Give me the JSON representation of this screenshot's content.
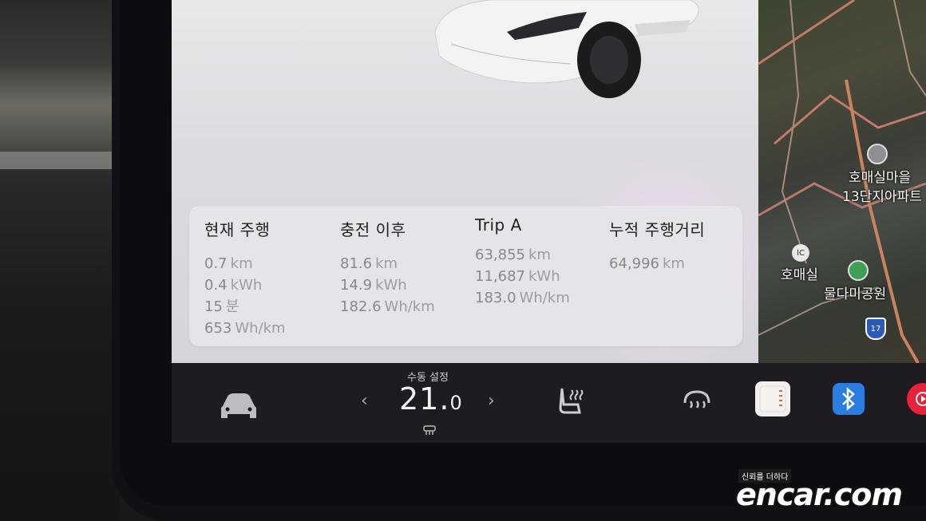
{
  "stats": {
    "current_trip": {
      "title": "현재 주행",
      "rows": [
        {
          "value": "0.7",
          "unit": "km"
        },
        {
          "value": "0.4",
          "unit": "kWh"
        },
        {
          "value": "15",
          "unit": "분"
        },
        {
          "value": "653",
          "unit": "Wh/km"
        }
      ]
    },
    "since_charge": {
      "title": "충전 이후",
      "rows": [
        {
          "value": "81.6",
          "unit": "km"
        },
        {
          "value": "14.9",
          "unit": "kWh"
        },
        {
          "value": "182.6",
          "unit": "Wh/km"
        }
      ]
    },
    "trip_a": {
      "title": "Trip A",
      "rows": [
        {
          "value": "63,855",
          "unit": "km"
        },
        {
          "value": "11,687",
          "unit": "kWh"
        },
        {
          "value": "183.0",
          "unit": "Wh/km"
        }
      ]
    },
    "odometer": {
      "title": "누적 주행거리",
      "rows": [
        {
          "value": "64,996",
          "unit": "km"
        }
      ]
    }
  },
  "map": {
    "labels": [
      "호매실마을",
      "13단지아파트",
      "IC",
      "호매실",
      "물다미공원",
      "17"
    ]
  },
  "climate": {
    "mode_label": "수동 설정",
    "temp_int": "21.",
    "temp_dec": "0",
    "left_chevron": "‹",
    "right_chevron": "›"
  },
  "watermark": {
    "tagline": "신뢰를 더하다",
    "brand": "encar.com"
  },
  "icons": [
    "car-icon",
    "seat-heater-icon",
    "rear-defrost-icon",
    "calendar-icon",
    "bluetooth-icon",
    "media-icon",
    "fan-icon"
  ]
}
